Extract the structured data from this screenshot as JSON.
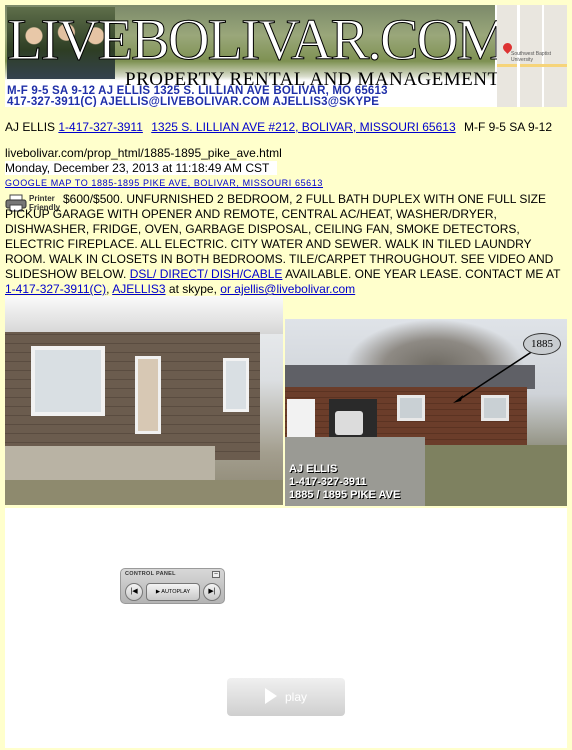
{
  "banner": {
    "title": "LIVEBOLIVAR.COM",
    "subtitle": "PROPERTY RENTAL AND MANAGEMENT",
    "line1": "M-F 9-5  SA 9-12   AJ ELLIS 1325 S. LILLIAN AVE BOLIVAR, MO 65613",
    "line2": "417-327-3911(C)   AJELLIS@LIVEBOLIVAR.COM   AJELLIS3@SKYPE"
  },
  "contact": {
    "name": "AJ ELLIS",
    "phone": "1-417-327-3911",
    "address": "1325 S. LILLIAN AVE #212, BOLIVAR, MISSOURI 65613",
    "hours": "M-F 9-5 SA 9-12"
  },
  "page": {
    "url": "livebolivar.com/prop_html/1885-1895_pike_ave.html",
    "timestamp": "Monday, December 23, 2013 at 11:18:49 AM CST",
    "map_link": "GOOGLE MAP TO 1885-1895 PIKE AVE, BOLIVAR, MISSOURI 65613",
    "printer_label": "Printer Friendly"
  },
  "description": {
    "text": "$600/$500.  UNFURNISHED 2 BEDROOM, 2 FULL BATH DUPLEX WITH ONE FULL SIZE PICKUP GARAGE WITH OPENER AND REMOTE, CENTRAL AC/HEAT, WASHER/DRYER, DISHWASHER, FRIDGE, OVEN, GARBAGE DISPOSAL, CEILING FAN, SMOKE DETECTORS, ELECTRIC FIREPLACE.  ALL ELECTRIC.  CITY WATER AND SEWER.  WALK IN TILED LAUNDRY ROOM.  WALK IN CLOSETS IN BOTH BEDROOMS.   TILE/CARPET THROUGHOUT.  SEE VIDEO AND SLIDESHOW BELOW.  ",
    "dsl_link": "DSL/ DIRECT/ DISH/CABLE",
    "available_text": " AVAILABLE.  ONE YEAR LEASE.  CONTACT ME AT ",
    "phone_link": "1-417-327-3911(C)",
    "comma": ", ",
    "skype_link": "AJELLIS3",
    "skype_text": " at skype, ",
    "email_link": "or ajellis@livebolivar.com"
  },
  "photo2": {
    "number_sign": "1885",
    "caption_line1": "AJ ELLIS",
    "caption_line2": "1-417-327-3911",
    "caption_line3": "1885 / 1895 PIKE AVE"
  },
  "slideshow": {
    "panel_title": "CONTROL PANEL",
    "close_glyph": "–",
    "prev_glyph": "|◀",
    "autoplay_label": "▶ AUTOPLAY",
    "next_glyph": "▶|",
    "play_label": "play"
  },
  "map_thumb": {
    "label": "Southwest Baptist University"
  }
}
